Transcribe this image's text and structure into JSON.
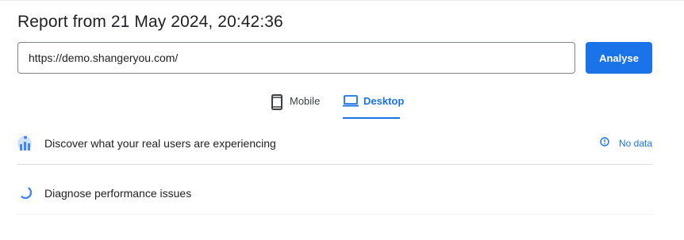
{
  "report": {
    "title": "Report from 21 May 2024, 20:42:36"
  },
  "url_bar": {
    "value": "https://demo.shangeryou.com/"
  },
  "analyse_button": {
    "label": "Analyse"
  },
  "tabs": [
    {
      "label": "Mobile",
      "icon": "mobile-phone-icon",
      "selected": false
    },
    {
      "label": "Desktop",
      "icon": "laptop-icon",
      "selected": true
    }
  ],
  "sections": {
    "field_data": {
      "title": "Discover what your real users are experiencing",
      "icon": "crux-users-icon",
      "status": {
        "label": "No data",
        "icon": "info-icon"
      }
    },
    "diagnose": {
      "title": "Diagnose performance issues",
      "icon": "loading-spinner-icon"
    }
  },
  "colors": {
    "accent": "#1a73e8",
    "text": "#202124",
    "border": "#80868b",
    "divider": "#dadce0"
  }
}
